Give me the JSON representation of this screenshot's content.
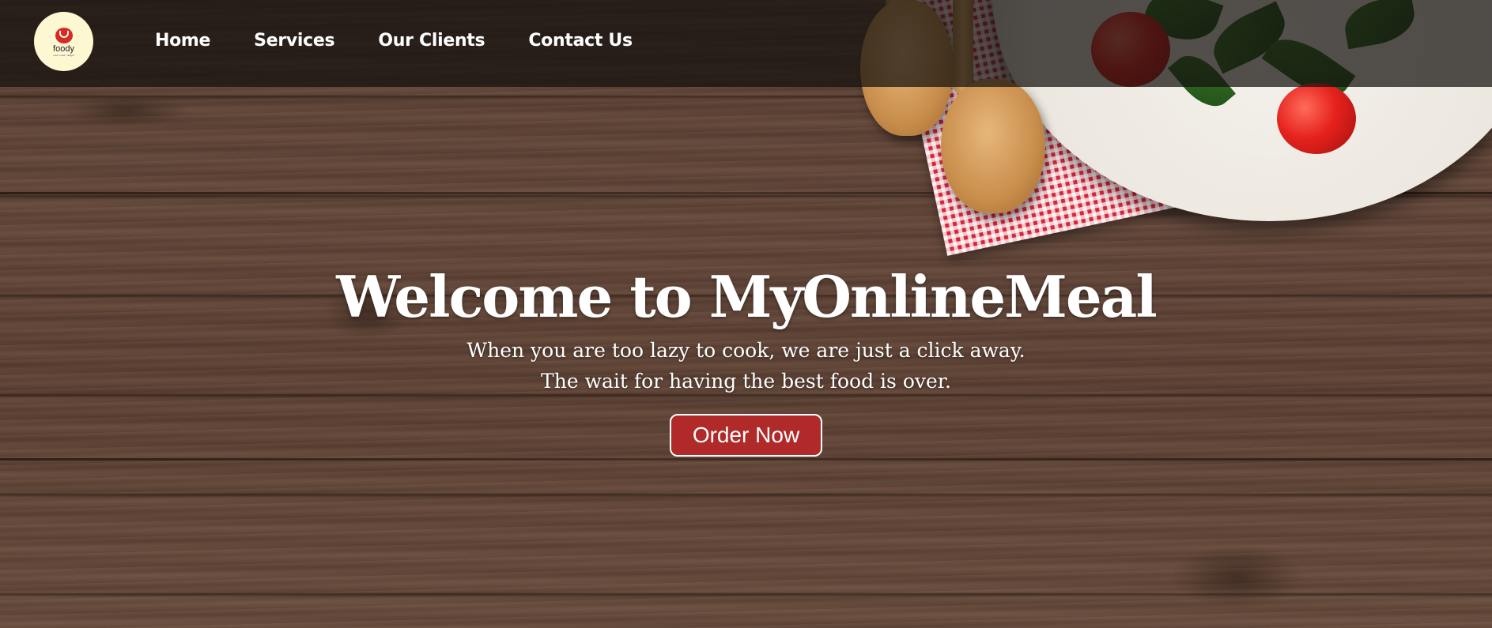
{
  "brand": {
    "logo_text": "foody",
    "logo_tagline": "cook • food • delight"
  },
  "nav": {
    "items": [
      {
        "label": "Home"
      },
      {
        "label": "Services"
      },
      {
        "label": "Our Clients"
      },
      {
        "label": "Contact Us"
      }
    ]
  },
  "hero": {
    "title": "Welcome to MyOnlineMeal",
    "subtitle_line1": "When you are too lazy to cook, we are just a click away.",
    "subtitle_line2": "The wait for having the best food is over.",
    "cta_label": "Order Now"
  },
  "colors": {
    "nav_background": "#1a1512",
    "cta_background": "#b02a2a",
    "logo_background": "#fdf8d2",
    "text": "#ffffff"
  }
}
